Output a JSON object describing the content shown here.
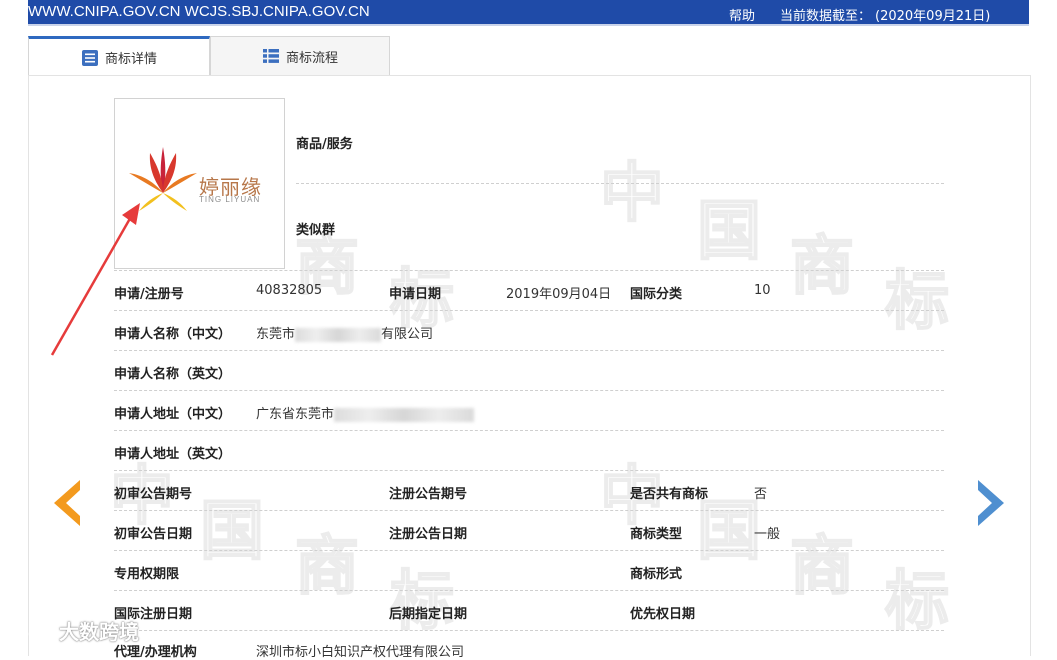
{
  "topbar": {
    "sites": "WWW.CNIPA.GOV.CN WCJS.SBJ.CNIPA.GOV.CN",
    "help": "帮助",
    "as_of_label": "当前数据截至：",
    "as_of_date": "(2020年09月21日)"
  },
  "tabs": [
    {
      "label": "商标详情",
      "active": true,
      "icon": "detail-list-icon"
    },
    {
      "label": "商标流程",
      "active": false,
      "icon": "process-list-icon"
    }
  ],
  "logo": {
    "brand_cn": "婷丽缘",
    "brand_en": "TING LIYUAN",
    "icon": "leaf-flame-logo"
  },
  "fields": {
    "goods_services": "商品/服务",
    "similar_group": "类似群",
    "reg_no_label": "申请/注册号",
    "reg_no": "40832805",
    "apply_date_label": "申请日期",
    "apply_date": "2019年09月04日",
    "intl_class_label": "国际分类",
    "intl_class": "10",
    "applicant_cn_label": "申请人名称（中文）",
    "applicant_cn_prefix": "东莞市",
    "applicant_cn_suffix": "有限公司",
    "applicant_en_label": "申请人名称（英文）",
    "address_cn_label": "申请人地址（中文）",
    "address_cn_prefix": "广东省东莞市",
    "address_en_label": "申请人地址（英文）",
    "prelim_pub_no_label": "初审公告期号",
    "reg_pub_no_label": "注册公告期号",
    "shared_label": "是否共有商标",
    "shared": "否",
    "prelim_pub_date_label": "初审公告日期",
    "reg_pub_date_label": "注册公告日期",
    "tm_type_label": "商标类型",
    "tm_type": "一般",
    "exclusive_period_label": "专用权期限",
    "tm_form_label": "商标形式",
    "intl_reg_date_label": "国际注册日期",
    "later_designation_label": "后期指定日期",
    "priority_date_label": "优先权日期",
    "agent_label": "代理/办理机构",
    "agent": "深圳市标小白知识产权代理有限公司"
  },
  "nav": {
    "prev": "prev-arrow-icon",
    "next": "next-arrow-icon"
  },
  "watermark": {
    "char1": "中",
    "char2": "国",
    "char3": "商",
    "char4": "标",
    "brand": "大数跨境"
  },
  "colors": {
    "topbar": "#1f4ba8",
    "prev_arrow": "#f39a1e",
    "next_arrow": "#4f8fd0",
    "annotation": "#e63b3b"
  }
}
